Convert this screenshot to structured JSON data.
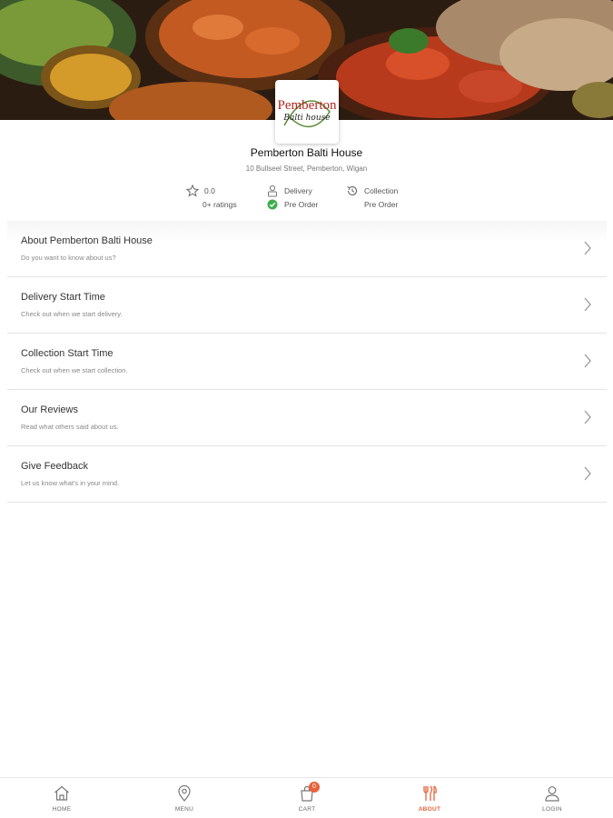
{
  "restaurant": {
    "logo_text_1": "Pemberton",
    "logo_text_2": "Balti house",
    "name": "Pemberton Balti House",
    "address": "10 Bullseel Street, Pemberton, Wigan",
    "rating": "0.0",
    "ratings_count": "0+ ratings",
    "delivery_label": "Delivery",
    "delivery_status": "Pre Order",
    "collection_label": "Collection",
    "collection_status": "Pre Order"
  },
  "menu_items": [
    {
      "title": "About Pemberton Balti House",
      "subtitle": "Do you want to know about us?"
    },
    {
      "title": "Delivery Start Time",
      "subtitle": "Check out when we start delivery."
    },
    {
      "title": "Collection Start Time",
      "subtitle": "Check out when we start collection."
    },
    {
      "title": "Our Reviews",
      "subtitle": "Read what others said about us."
    },
    {
      "title": "Give Feedback",
      "subtitle": "Let us know what's in your mind."
    }
  ],
  "nav": {
    "home": "HOME",
    "menu": "MENU",
    "cart": "CART",
    "cart_count": "0",
    "about": "ABOUT",
    "login": "LOGIN"
  },
  "colors": {
    "accent": "#e8643c",
    "success": "#3cae4c"
  },
  "icons": [
    "star-icon",
    "delivery-person-icon",
    "check-circle-icon",
    "clock-history-icon",
    "chevron-right-icon",
    "home-icon",
    "location-pin-icon",
    "cart-icon",
    "cutlery-icon",
    "user-icon"
  ]
}
